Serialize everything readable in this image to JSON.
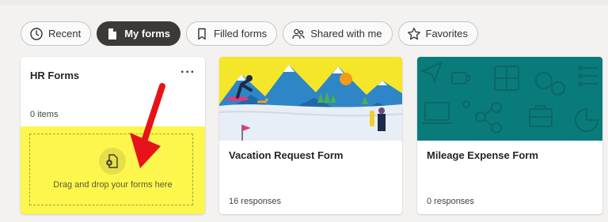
{
  "filters": [
    {
      "label": "Recent",
      "icon": "clock-icon",
      "active": false
    },
    {
      "label": "My forms",
      "icon": "document-icon",
      "active": true
    },
    {
      "label": "Filled forms",
      "icon": "bookmark-icon",
      "active": false
    },
    {
      "label": "Shared with me",
      "icon": "people-icon",
      "active": false
    },
    {
      "label": "Favorites",
      "icon": "star-icon",
      "active": false
    }
  ],
  "collection": {
    "title": "HR Forms",
    "more_label": "···",
    "count": "0 items",
    "drop_text": "Drag and drop your forms here"
  },
  "forms": [
    {
      "title": "Vacation Request Form",
      "responses": "16 responses",
      "thumbnail": "mountain-ski-illustration"
    },
    {
      "title": "Mileage Expense Form",
      "responses": "0 responses",
      "thumbnail": "office-icons-pattern"
    }
  ],
  "colors": {
    "active_pill": "#3b3a39",
    "drop_highlight": "#fdf64c",
    "arrow": "#e8121a",
    "mileage_thumb": "#0a7b7b",
    "sky": "#f5e62a"
  }
}
